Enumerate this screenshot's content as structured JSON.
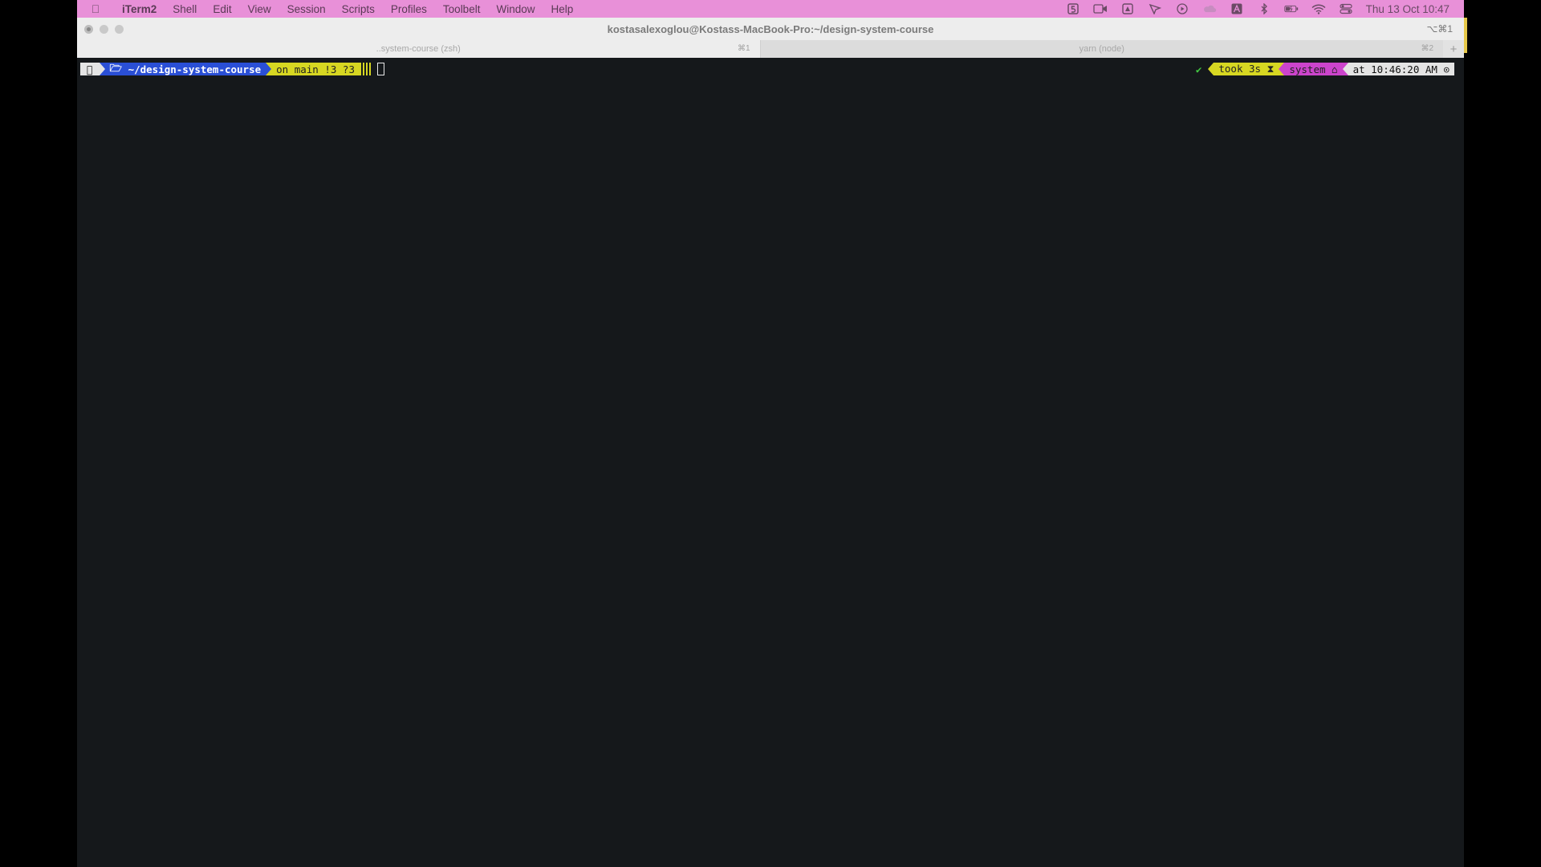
{
  "menubar": {
    "items": [
      "iTerm2",
      "Shell",
      "Edit",
      "View",
      "Session",
      "Scripts",
      "Profiles",
      "Toolbelt",
      "Window",
      "Help"
    ],
    "clock": "Thu 13 Oct  10:47",
    "status_icons": [
      "five-icon",
      "camera-icon",
      "drive-icon",
      "cursor-app-icon",
      "play-icon",
      "cloud-icon",
      "input-source-icon",
      "bluetooth-icon",
      "battery-icon",
      "wifi-icon",
      "control-center-icon"
    ]
  },
  "window": {
    "title": "kostasalexoglou@Kostass-MacBook-Pro:~/design-system-course",
    "shortcut": "⌥⌘1",
    "tabs": [
      {
        "label": "..system-course (zsh)",
        "shortcut": "⌘1"
      },
      {
        "label": "yarn (node)",
        "shortcut": "⌘2"
      }
    ],
    "new_tab": "+"
  },
  "prompt": {
    "dir": "~/design-system-course",
    "git": "on  main !3 ?3",
    "status": "✔",
    "took": "took 3s ⧗",
    "env": "system ⌂",
    "time": "at 10:46:20 AM ⊙"
  },
  "colors": {
    "menubar_bg": "#e890d8",
    "dir_segment": "#2a4fd6",
    "git_segment": "#d7d722",
    "env_segment": "#cc44cc",
    "terminal_bg": "#15181b"
  }
}
